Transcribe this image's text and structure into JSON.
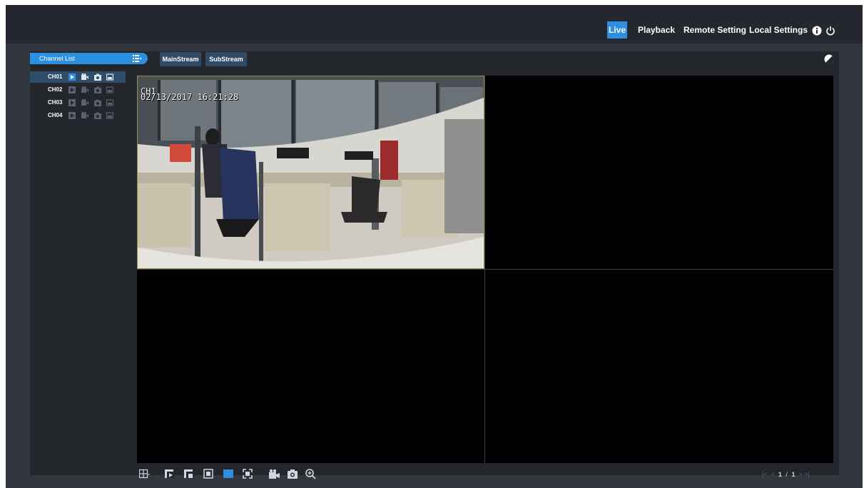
{
  "nav": {
    "items": [
      {
        "label": "Live",
        "active": true
      },
      {
        "label": "Playback",
        "active": false
      },
      {
        "label": "Remote Setting",
        "active": false
      },
      {
        "label": "Local Settings",
        "active": false
      }
    ],
    "icons": [
      "info-icon",
      "power-icon"
    ]
  },
  "channel_list": {
    "title": "Channel List",
    "toggle_icon": "list-collapse-icon",
    "channels": [
      {
        "name": "CH01",
        "selected": true,
        "icons": [
          "live-view-icon",
          "record-icon",
          "snapshot-icon",
          "image-icon"
        ]
      },
      {
        "name": "CH02",
        "selected": false,
        "icons": [
          "live-view-icon",
          "record-icon",
          "snapshot-icon",
          "image-icon"
        ]
      },
      {
        "name": "CH03",
        "selected": false,
        "icons": [
          "live-view-icon",
          "record-icon",
          "snapshot-icon",
          "image-icon"
        ]
      },
      {
        "name": "CH04",
        "selected": false,
        "icons": [
          "live-view-icon",
          "record-icon",
          "snapshot-icon",
          "image-icon"
        ]
      }
    ]
  },
  "streams": {
    "main_label": "MainStream",
    "sub_label": "SubStream"
  },
  "display_mode_icon": "contrast-icon",
  "video": {
    "ch1_osd_name": "CH1",
    "ch1_osd_datetime": "02/13/2017 16:21:28"
  },
  "toolbar": {
    "icons": [
      "layout-icon",
      "previous-screen-icon",
      "next-screen-icon",
      "single-view-icon",
      "stretch-view-icon",
      "fullscreen-icon",
      "record-all-icon",
      "snapshot-icon",
      "zoom-icon"
    ]
  },
  "pager": {
    "current": "1",
    "separator": "/",
    "total": "1"
  },
  "colors": {
    "accent": "#2f8ee0",
    "selected_row": "#2f4c69",
    "background": "#32363e",
    "panel": "#23262b"
  }
}
